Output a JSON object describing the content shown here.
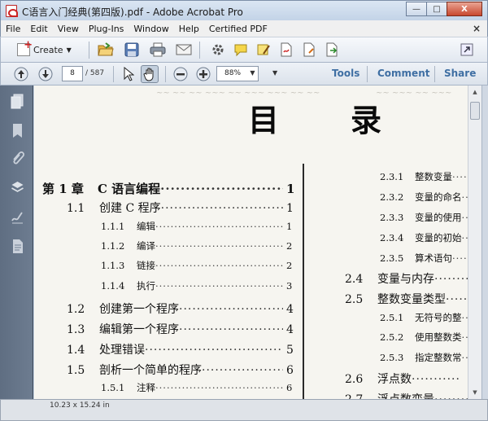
{
  "window": {
    "title": "C语言入门经典(第四版).pdf - Adobe Acrobat Pro",
    "minimize": "—",
    "maximize": "□",
    "close": "X"
  },
  "menu": [
    "File",
    "Edit",
    "View",
    "Plug-Ins",
    "Window",
    "Help",
    "Certified PDF"
  ],
  "toolbar": {
    "create_label": "Create",
    "page_current": "8",
    "page_total": "/ 587",
    "zoom": "88%",
    "tools": "Tools",
    "comment": "Comment",
    "share": "Share"
  },
  "document": {
    "title_left": "目",
    "title_right": "录",
    "toc_left": [
      {
        "num": "第 1 章",
        "text": "C 语言编程",
        "page": "1",
        "level": 0
      },
      {
        "num": "1.1",
        "text": "创建 C 程序",
        "page": "1",
        "level": 1
      },
      {
        "num": "1.1.1",
        "text": "编辑",
        "page": "1",
        "level": 2
      },
      {
        "num": "1.1.2",
        "text": "编译",
        "page": "2",
        "level": 2
      },
      {
        "num": "1.1.3",
        "text": "链接",
        "page": "2",
        "level": 2
      },
      {
        "num": "1.1.4",
        "text": "执行",
        "page": "3",
        "level": 2
      },
      {
        "num": "1.2",
        "text": "创建第一个程序",
        "page": "4",
        "level": 1
      },
      {
        "num": "1.3",
        "text": "编辑第一个程序",
        "page": "4",
        "level": 1
      },
      {
        "num": "1.4",
        "text": "处理错误",
        "page": "5",
        "level": 1
      },
      {
        "num": "1.5",
        "text": "剖析一个简单的程序",
        "page": "6",
        "level": 1
      },
      {
        "num": "1.5.1",
        "text": "注释",
        "page": "6",
        "level": 2
      }
    ],
    "toc_right": [
      {
        "num": "2.3.1",
        "text": "整数变量",
        "level": 2
      },
      {
        "num": "2.3.2",
        "text": "变量的命名",
        "level": 2
      },
      {
        "num": "2.3.3",
        "text": "变量的使用",
        "level": 2
      },
      {
        "num": "2.3.4",
        "text": "变量的初始",
        "level": 2
      },
      {
        "num": "2.3.5",
        "text": "算术语句",
        "level": 2
      },
      {
        "num": "2.4",
        "text": "变量与内存",
        "level": 1
      },
      {
        "num": "2.5",
        "text": "整数变量类型",
        "level": 1
      },
      {
        "num": "2.5.1",
        "text": "无符号的整",
        "level": 2
      },
      {
        "num": "2.5.2",
        "text": "使用整数类",
        "level": 2
      },
      {
        "num": "2.5.3",
        "text": "指定整数常",
        "level": 2
      },
      {
        "num": "2.6",
        "text": "浮点数",
        "level": 1
      },
      {
        "num": "2.7",
        "text": "浮点数变量",
        "level": 1
      }
    ]
  },
  "statusbar": {
    "page_size": "10.23 x 15.24 in"
  }
}
